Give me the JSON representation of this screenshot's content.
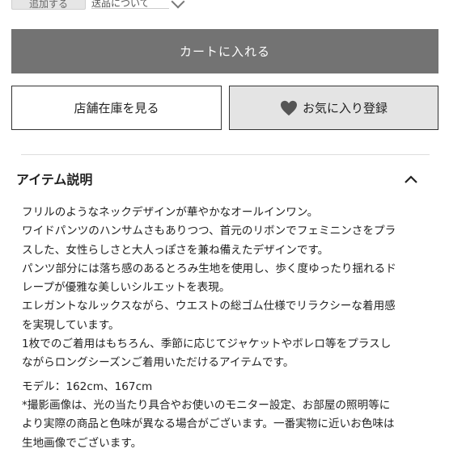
{
  "top": {
    "quantity_label": "追加する",
    "shipping_label": "送品について"
  },
  "actions": {
    "add_to_cart": "カートに入れる",
    "store_stock": "店舗在庫を見る",
    "favorite": "お気に入り登録"
  },
  "item": {
    "section_title": "アイテム説明",
    "description_lines": [
      "フリルのようなネックデザインが華やかなオールインワン。",
      "ワイドパンツのハンサムさもありつつ、首元のリボンでフェミニンさをプラ",
      "スした、女性らしさと大人っぽさを兼ね備えたデザインです。",
      "パンツ部分には落ち感のあるとろみ生地を使用し、歩く度ゆったり揺れるド",
      "レープが優雅な美しいシルエットを表現。",
      "エレガントなルックスながら、ウエストの総ゴム仕様でリラクシーな着用感",
      "を実現しています。",
      "1枚でのご着用はもちろん、季節に応じてジャケットやボレロ等をプラスし",
      "ながらロングシーズンご着用いただけるアイテムです。"
    ],
    "model_info": "モデル：162cm、167cm",
    "note_lines": [
      "*撮影画像は、光の当たり具合やお使いのモニター設定、お部屋の照明等に",
      "より実際の商品と色味が異なる場合がございます。一番実物に近いお色味は",
      "生地画像でございます。"
    ]
  },
  "icons": {
    "favorite": "heart-icon",
    "collapse": "chevron-up-icon",
    "dropdown": "chevron-down-icon"
  },
  "colors": {
    "cart_button": "#737373",
    "favorite_button": "#e4e4e4",
    "heart": "#555555"
  }
}
